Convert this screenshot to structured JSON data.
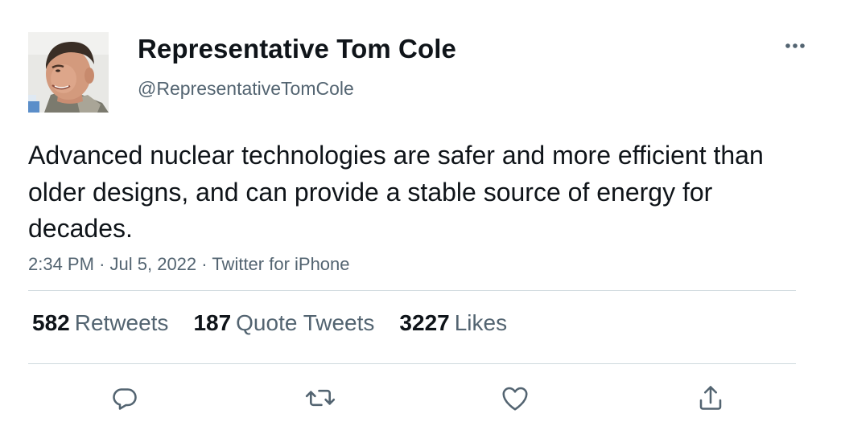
{
  "user": {
    "display_name": "Representative Tom Cole",
    "handle": "@RepresentativeTomCole"
  },
  "tweet": {
    "text": "Advanced nuclear technologies are safer and more efficient than older designs, and can provide a stable source of energy for decades.",
    "time": "2:34 PM",
    "date": "Jul 5, 2022",
    "source": "Twitter for iPhone"
  },
  "stats": {
    "retweets_count": "582",
    "retweets_label": "Retweets",
    "quotes_count": "187",
    "quotes_label": "Quote Tweets",
    "likes_count": "3227",
    "likes_label": "Likes"
  },
  "icons": {
    "more": "more-horizontal-icon",
    "reply": "reply-icon",
    "retweet": "retweet-icon",
    "like": "heart-icon",
    "share": "share-icon"
  },
  "colors": {
    "text_primary": "#0f1419",
    "text_secondary": "#536471",
    "divider": "#cfd9de"
  }
}
